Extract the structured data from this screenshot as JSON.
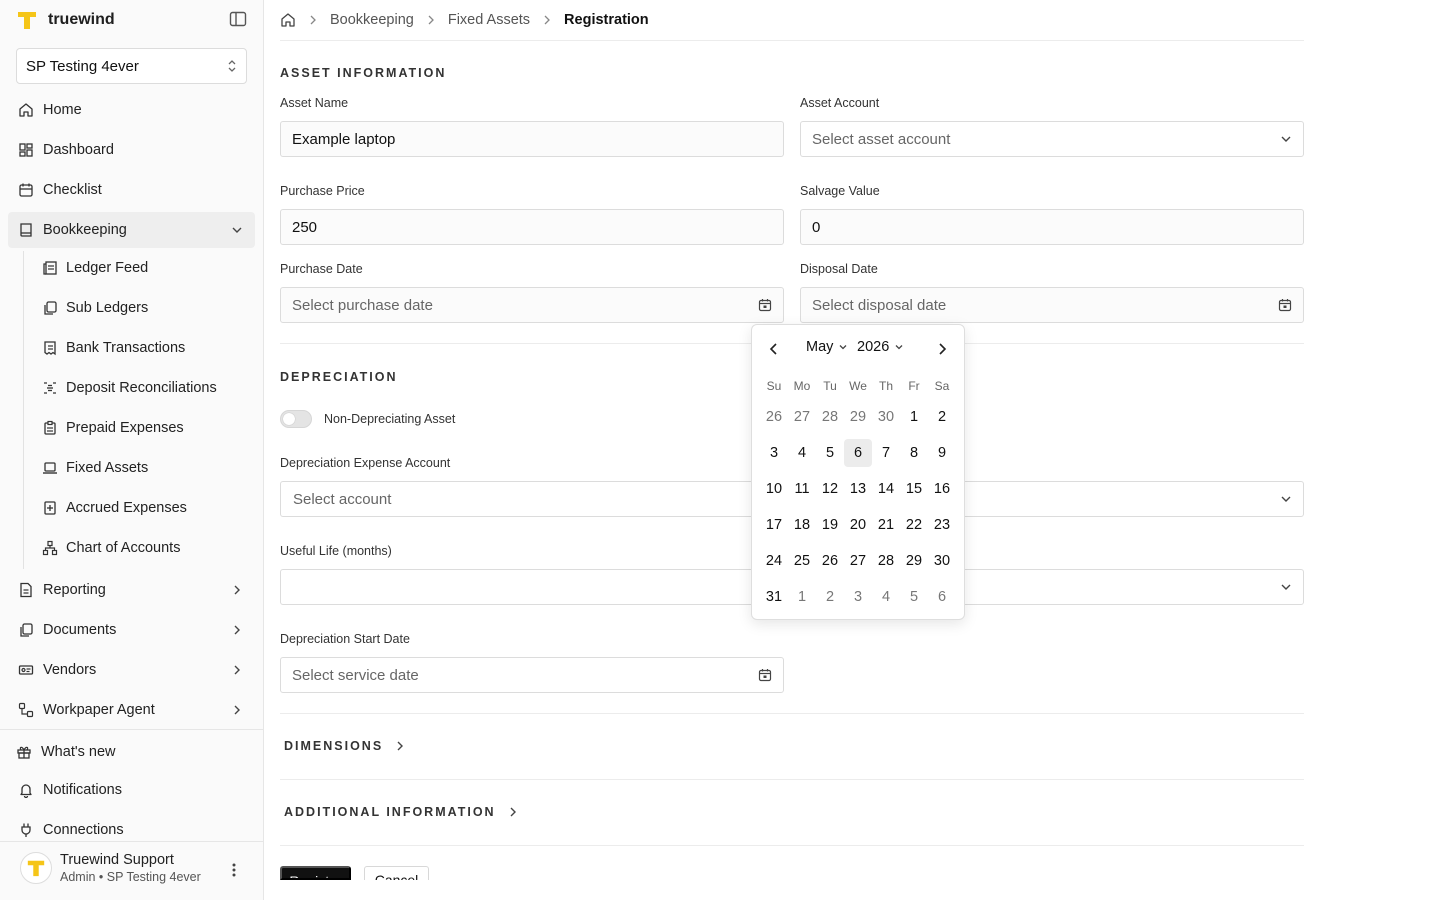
{
  "sidebar": {
    "brand": "truewind",
    "org": "SP Testing 4ever",
    "nav": [
      {
        "label": "Home",
        "icon": "home-icon"
      },
      {
        "label": "Dashboard",
        "icon": "dashboard-icon"
      },
      {
        "label": "Checklist",
        "icon": "calendar-check-icon"
      },
      {
        "label": "Bookkeeping",
        "icon": "book-icon"
      }
    ],
    "bookkeeping_items": [
      {
        "label": "Ledger Feed",
        "icon": "ledger-icon"
      },
      {
        "label": "Sub Ledgers",
        "icon": "copy-icon"
      },
      {
        "label": "Bank Transactions",
        "icon": "receipt-icon"
      },
      {
        "label": "Deposit Reconciliations",
        "icon": "reconcile-icon"
      },
      {
        "label": "Prepaid Expenses",
        "icon": "clipboard-icon"
      },
      {
        "label": "Fixed Assets",
        "icon": "laptop-icon"
      },
      {
        "label": "Accrued Expenses",
        "icon": "plus-box-icon"
      },
      {
        "label": "Chart of Accounts",
        "icon": "hierarchy-icon"
      }
    ],
    "nav_more": [
      {
        "label": "Reporting",
        "icon": "report-icon"
      },
      {
        "label": "Documents",
        "icon": "documents-icon"
      },
      {
        "label": "Vendors",
        "icon": "vendor-icon"
      },
      {
        "label": "Workpaper Agent",
        "icon": "agent-icon"
      }
    ],
    "footer_items": [
      {
        "label": "What's new",
        "icon": "gift-icon"
      },
      {
        "label": "Notifications",
        "icon": "bell-icon"
      },
      {
        "label": "Connections",
        "icon": "plug-icon"
      }
    ],
    "user": {
      "name": "Truewind Support",
      "role": "Admin • SP Testing 4ever"
    }
  },
  "breadcrumb": [
    "Bookkeeping",
    "Fixed Assets",
    "Registration"
  ],
  "asset_info": {
    "title": "ASSET INFORMATION",
    "asset_name_label": "Asset Name",
    "asset_name_value": "Example laptop",
    "asset_account_label": "Asset Account",
    "asset_account_placeholder": "Select asset account",
    "purchase_price_label": "Purchase Price",
    "purchase_price_value": "250",
    "salvage_value_label": "Salvage Value",
    "salvage_value_value": "0",
    "purchase_date_label": "Purchase Date",
    "purchase_date_placeholder": "Select purchase date",
    "disposal_date_label": "Disposal Date",
    "disposal_date_placeholder": "Select disposal date"
  },
  "depreciation": {
    "title": "DEPRECIATION",
    "toggle_label": "Non-Depreciating Asset",
    "toggle_on": false,
    "expense_account_label": "Depreciation Expense Account",
    "expense_account_placeholder": "Select account",
    "useful_life_label": "Useful Life (months)",
    "start_date_label": "Depreciation Start Date",
    "start_date_placeholder": "Select service date"
  },
  "sections": {
    "dimensions": "DIMENSIONS",
    "additional": "ADDITIONAL INFORMATION"
  },
  "actions": {
    "register": "Register",
    "cancel": "Cancel"
  },
  "calendar": {
    "month": "May",
    "year": "2026",
    "weekdays": [
      "Su",
      "Mo",
      "Tu",
      "We",
      "Th",
      "Fr",
      "Sa"
    ],
    "highlighted_day": "6",
    "weeks": [
      [
        "26",
        "27",
        "28",
        "29",
        "30",
        "1",
        "2"
      ],
      [
        "3",
        "4",
        "5",
        "6",
        "7",
        "8",
        "9"
      ],
      [
        "10",
        "11",
        "12",
        "13",
        "14",
        "15",
        "16"
      ],
      [
        "17",
        "18",
        "19",
        "20",
        "21",
        "22",
        "23"
      ],
      [
        "24",
        "25",
        "26",
        "27",
        "28",
        "29",
        "30"
      ],
      [
        "31",
        "1",
        "2",
        "3",
        "4",
        "5",
        "6"
      ]
    ]
  }
}
